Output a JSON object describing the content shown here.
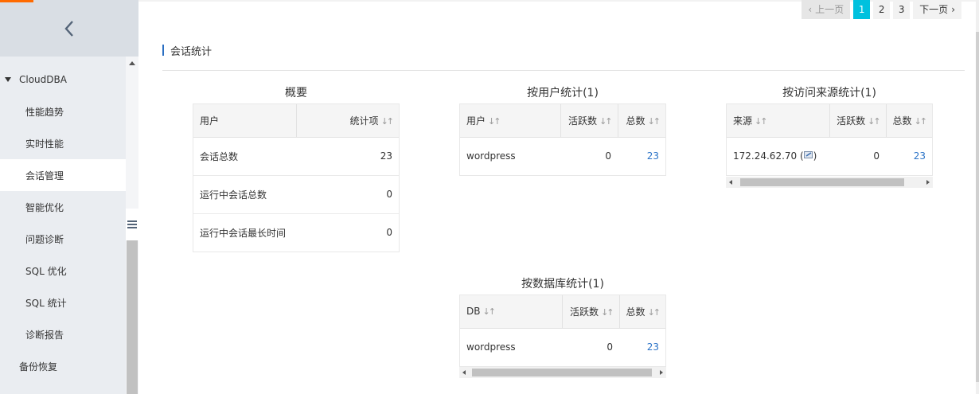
{
  "sidebar": {
    "items": [
      {
        "label": "CloudDBA",
        "type": "group"
      },
      {
        "label": "性能趋势",
        "type": "sub"
      },
      {
        "label": "实时性能",
        "type": "sub"
      },
      {
        "label": "会话管理",
        "type": "sub",
        "active": true
      },
      {
        "label": "智能优化",
        "type": "sub"
      },
      {
        "label": "问题诊断",
        "type": "sub"
      },
      {
        "label": "SQL 优化",
        "type": "sub"
      },
      {
        "label": "SQL 统计",
        "type": "sub"
      },
      {
        "label": "诊断报告",
        "type": "sub"
      },
      {
        "label": "备份恢复",
        "type": "top"
      }
    ]
  },
  "pager": {
    "prev": "上一页",
    "pages": [
      "1",
      "2",
      "3"
    ],
    "current": "1",
    "next": "下一页"
  },
  "section": {
    "title": "会话统计"
  },
  "overview": {
    "title": "概要",
    "headers": [
      "用户",
      "统计项"
    ],
    "rows": [
      [
        "会话总数",
        "23"
      ],
      [
        "运行中会话总数",
        "0"
      ],
      [
        "运行中会话最长时间",
        "0"
      ]
    ]
  },
  "by_user": {
    "title": "按用户统计(1)",
    "headers": [
      "用户",
      "活跃数",
      "总数"
    ],
    "rows": [
      [
        "wordpress",
        "0",
        "23"
      ]
    ]
  },
  "by_source": {
    "title": "按访问来源统计(1)",
    "headers": [
      "来源",
      "活跃数",
      "总数"
    ],
    "rows": [
      [
        "172.24.62.70 (",
        "0",
        "23"
      ]
    ]
  },
  "by_db": {
    "title": "按数据库统计(1)",
    "headers": [
      "DB",
      "活跃数",
      "总数"
    ],
    "rows": [
      [
        "wordpress",
        "0",
        "23"
      ]
    ]
  },
  "colors": {
    "accent": "#00c1de",
    "link": "#2b73c7",
    "sidebar_bg": "#eaedf1",
    "brand": "#ff6a00"
  }
}
